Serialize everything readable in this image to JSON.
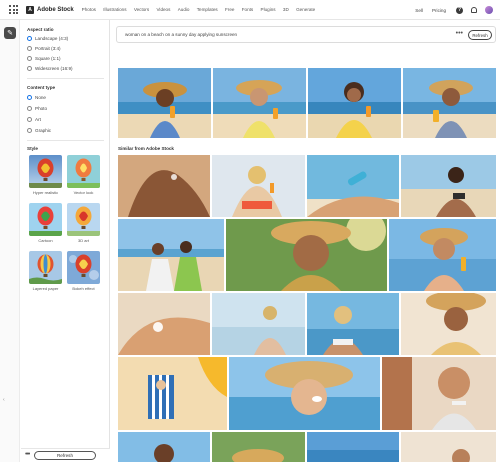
{
  "app": {
    "brand": "Adobe Stock",
    "logo_letter": "A"
  },
  "nav": {
    "items": [
      "Photos",
      "Illustrations",
      "Vectors",
      "Videos",
      "Audio",
      "Templates",
      "Free",
      "Fonts",
      "Plugins",
      "3D",
      "Generate"
    ],
    "right": {
      "sell": "Sell",
      "pricing": "Pricing"
    }
  },
  "panel": {
    "aspect": {
      "title": "Aspect ratio",
      "options": [
        "Landscape (4:3)",
        "Portrait (3:4)",
        "Square (1:1)",
        "Widescreen (16:9)"
      ],
      "selected": 0
    },
    "content": {
      "title": "Content type",
      "options": [
        "None",
        "Photo",
        "Art",
        "Graphic"
      ],
      "selected": 0
    },
    "style": {
      "title": "Style",
      "items": [
        "Hyper realistic",
        "Vector look",
        "Cartoon",
        "3D art",
        "Layered paper",
        "Bokeh effect"
      ]
    },
    "refresh_label": "Refresh",
    "more_label": "•••"
  },
  "prompt": {
    "text": "woman on a beach on a sunny day applying sunscreen",
    "more_label": "•••",
    "refresh_label": "Refresh"
  },
  "similar_title": "Similar from Adobe Stock",
  "icons": {
    "help": "?",
    "rail": "✎",
    "rail_arrow": "‹"
  },
  "colors": {
    "accent": "#1473e6"
  }
}
